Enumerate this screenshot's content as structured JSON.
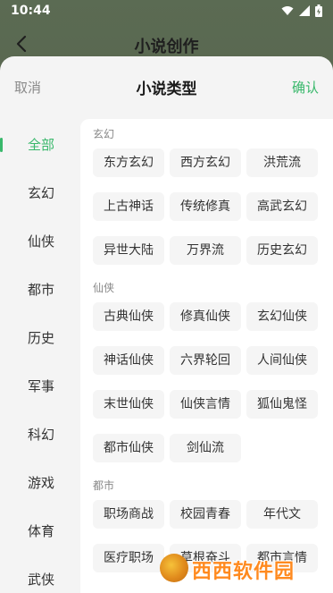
{
  "status_bar": {
    "time": "10:44"
  },
  "app_header": {
    "title": "小说创作"
  },
  "sheet": {
    "cancel_label": "取消",
    "title": "小说类型",
    "confirm_label": "确认"
  },
  "categories": [
    {
      "label": "全部",
      "active": true
    },
    {
      "label": "玄幻",
      "active": false
    },
    {
      "label": "仙侠",
      "active": false
    },
    {
      "label": "都市",
      "active": false
    },
    {
      "label": "历史",
      "active": false
    },
    {
      "label": "军事",
      "active": false
    },
    {
      "label": "科幻",
      "active": false
    },
    {
      "label": "游戏",
      "active": false
    },
    {
      "label": "体育",
      "active": false
    },
    {
      "label": "武侠",
      "active": false
    }
  ],
  "sections": [
    {
      "label": "玄幻",
      "tags": [
        "东方玄幻",
        "西方玄幻",
        "洪荒流",
        "上古神话",
        "传统修真",
        "高武玄幻",
        "异世大陆",
        "万界流",
        "历史玄幻"
      ]
    },
    {
      "label": "仙侠",
      "tags": [
        "古典仙侠",
        "修真仙侠",
        "玄幻仙侠",
        "神话仙侠",
        "六界轮回",
        "人间仙侠",
        "末世仙侠",
        "仙侠言情",
        "狐仙鬼怪",
        "都市仙侠",
        "剑仙流"
      ]
    },
    {
      "label": "都市",
      "tags": [
        "职场商战",
        "校园青春",
        "年代文",
        "医疗职场",
        "草根奋斗",
        "都市言情"
      ]
    }
  ],
  "watermark": {
    "text": "西西软件园"
  },
  "colors": {
    "accent": "#39b86b"
  }
}
